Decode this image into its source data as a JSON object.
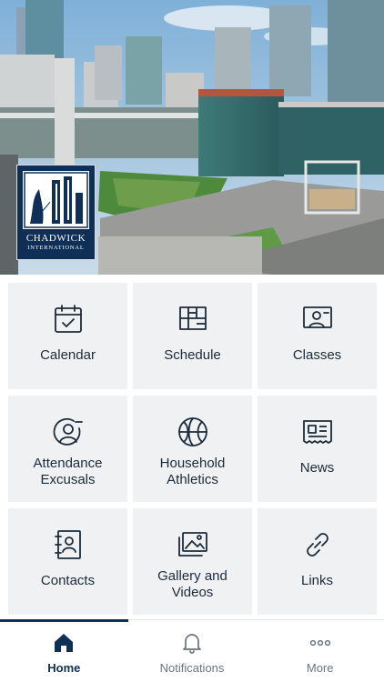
{
  "colors": {
    "brand_navy": "#0f2f56",
    "tile_background": "#f0f1f2",
    "icon_stroke": "#1c2b3a",
    "nav_inactive": "#6b7480"
  },
  "header": {
    "logo": {
      "name": "CHADWICK",
      "subtitle": "INTERNATIONAL"
    }
  },
  "tiles": [
    {
      "label": "Calendar",
      "icon": "calendar-check-icon"
    },
    {
      "label": "Schedule",
      "icon": "schedule-grid-icon"
    },
    {
      "label": "Classes",
      "icon": "classroom-icon"
    },
    {
      "label": "Attendance\nExcusals",
      "icon": "user-minus-icon"
    },
    {
      "label": "Household\nAthletics",
      "icon": "basketball-icon"
    },
    {
      "label": "News",
      "icon": "newspaper-icon"
    },
    {
      "label": "Contacts",
      "icon": "address-book-icon"
    },
    {
      "label": "Gallery and\nVideos",
      "icon": "gallery-icon"
    },
    {
      "label": "Links",
      "icon": "link-icon"
    }
  ],
  "nav": {
    "items": [
      {
        "label": "Home",
        "icon": "home-icon",
        "active": true
      },
      {
        "label": "Notifications",
        "icon": "bell-icon",
        "active": false
      },
      {
        "label": "More",
        "icon": "more-dots-icon",
        "active": false
      }
    ]
  }
}
